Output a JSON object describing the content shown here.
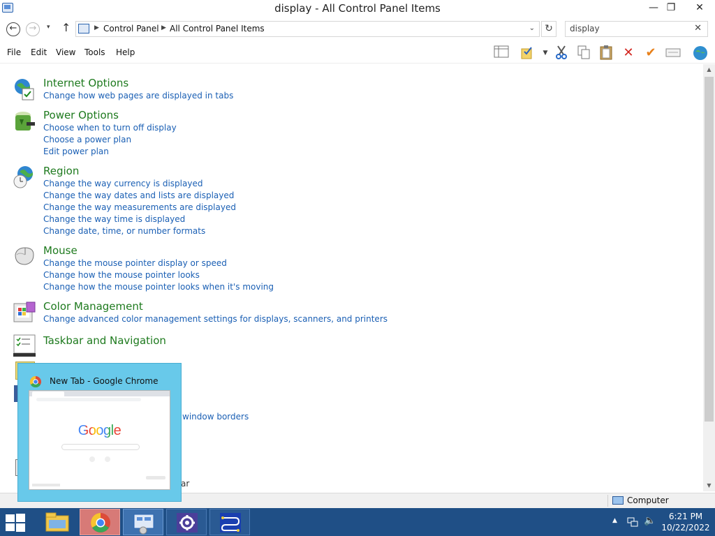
{
  "window": {
    "title": "display - All Control Panel Items",
    "min_glyph": "—",
    "restore_glyph": "❐",
    "close_glyph": "✕"
  },
  "nav": {
    "back_glyph": "←",
    "forward_glyph": "→",
    "up_glyph": "↑",
    "recent_glyph": "▾",
    "breadcrumb": [
      "Control Panel",
      "All Control Panel Items"
    ],
    "refresh_glyph": "↻",
    "search_value": "display",
    "search_clear": "✕"
  },
  "menu": {
    "items": [
      "File",
      "Edit",
      "View",
      "Tools",
      "Help"
    ]
  },
  "toolbar": {
    "icons": [
      "layout-icon",
      "folder-options-icon",
      "cut-icon",
      "copy-icon",
      "paste-icon",
      "delete-icon",
      "checkmark-icon",
      "properties-icon",
      "globe-icon"
    ]
  },
  "results": [
    {
      "title": "Internet Options",
      "icon": "internet-options-icon",
      "tasks": [
        "Change how web pages are displayed in tabs"
      ]
    },
    {
      "title": "Power Options",
      "icon": "power-options-icon",
      "tasks": [
        "Choose when to turn off display",
        "Choose a power plan",
        "Edit power plan"
      ]
    },
    {
      "title": "Region",
      "icon": "region-icon",
      "tasks": [
        "Change the way currency is displayed",
        "Change the way dates and lists are displayed",
        "Change the way measurements are displayed",
        "Change the way time is displayed",
        "Change date, time, or number formats"
      ]
    },
    {
      "title": "Mouse",
      "icon": "mouse-icon",
      "tasks": [
        "Change the mouse pointer display or speed",
        "Change how the mouse pointer looks",
        "Change how the mouse pointer looks when it's moving"
      ]
    },
    {
      "title": "Color Management",
      "icon": "color-management-icon",
      "tasks": [
        "Change advanced color management settings for displays, scanners, and printers"
      ]
    },
    {
      "title": "Taskbar and Navigation",
      "icon": "taskbar-navigation-icon",
      "tasks": []
    }
  ],
  "partially_hidden_text": [
    "window borders",
    "ar"
  ],
  "status": {
    "location": "Computer"
  },
  "taskbar": {
    "buttons": [
      "file-explorer",
      "google-chrome",
      "control-panel",
      "settings",
      "network-app"
    ],
    "clock_time": "6:21 PM",
    "clock_date": "10/22/2022"
  },
  "thumbnail": {
    "title": "New Tab - Google Chrome",
    "preview_logo": "Google"
  },
  "colors": {
    "title_green": "#1e7a1e",
    "link_blue": "#1a5fb4",
    "taskbar": "#1f4f86",
    "thumbnail_bg": "#68c9ea"
  }
}
